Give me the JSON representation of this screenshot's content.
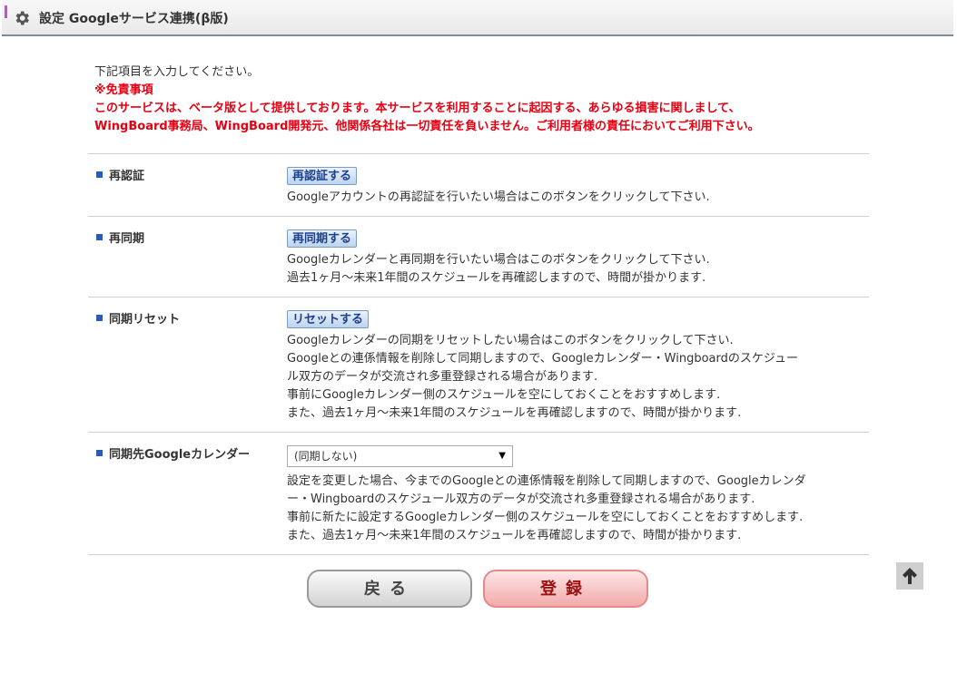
{
  "header": {
    "title": "設定 Googleサービス連携(β版)",
    "icon": "gear-icon"
  },
  "intro": {
    "instruction": "下記項目を入力してください。",
    "disclaimer_title": "※免責事項",
    "disclaimer_line1": "このサービスは、ベータ版として提供しております。本サービスを利用することに起因する、あらゆる損害に関しまして、",
    "disclaimer_line2": "WingBoard事務局、WingBoard開発元、他関係各社は一切責任を負いません。ご利用者様の責任においてご利用下さい。"
  },
  "rows": {
    "reauth": {
      "label": "再認証",
      "button": "再認証する",
      "desc": [
        "Googleアカウントの再認証を行いたい場合はこのボタンをクリックして下さい."
      ]
    },
    "resync": {
      "label": "再同期",
      "button": "再同期する",
      "desc": [
        "Googleカレンダーと再同期を行いたい場合はこのボタンをクリックして下さい.",
        "過去1ヶ月〜未来1年間のスケジュールを再確認しますので、時間が掛かります."
      ]
    },
    "reset": {
      "label": "同期リセット",
      "button": "リセットする",
      "desc": [
        "Googleカレンダーの同期をリセットしたい場合はこのボタンをクリックして下さい.",
        "Googleとの連係情報を削除して同期しますので、Googleカレンダー・Wingboardのスケジュー",
        "ル双方のデータが交流され多重登録される場合があります.",
        "事前にGoogleカレンダー側のスケジュールを空にしておくことをおすすめします.",
        "また、過去1ヶ月〜未来1年間のスケジュールを再確認しますので、時間が掛かります."
      ]
    },
    "calendar": {
      "label": "同期先Googleカレンダー",
      "select_value": "(同期しない)",
      "desc": [
        "設定を変更した場合、今までのGoogleとの連係情報を削除して同期しますので、Googleカレンダ",
        "ー・Wingboardのスケジュール双方のデータが交流され多重登録される場合があります.",
        "事前に新たに設定するGoogleカレンダー側のスケジュールを空にしておくことをおすすめします.",
        "また、過去1ヶ月〜未来1年間のスケジュールを再確認しますので、時間が掛かります."
      ]
    }
  },
  "buttons": {
    "back": "戻る",
    "register": "登録"
  },
  "colors": {
    "warning_red": "#e60012",
    "bullet_blue": "#2a5bb5"
  }
}
